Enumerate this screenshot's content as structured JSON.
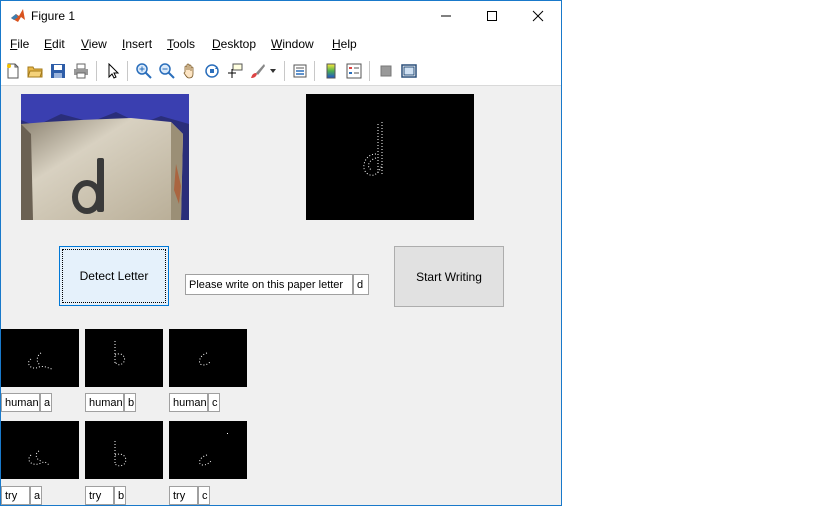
{
  "window": {
    "title": "Figure 1"
  },
  "menu": [
    "File",
    "Edit",
    "View",
    "Insert",
    "Tools",
    "Desktop",
    "Window",
    "Help"
  ],
  "toolbar": [
    "new-figure",
    "open-file",
    "save",
    "print",
    "edit-plot",
    "zoom-in",
    "zoom-out",
    "pan",
    "rotate-3d",
    "data-cursor",
    "brush",
    "link-plot",
    "colorbar",
    "legend",
    "hide-plot-tools",
    "show-plot-tools"
  ],
  "controls": {
    "detect_label": "Detect Letter",
    "instruction": "Please write on this paper letter",
    "letter": "d",
    "start_label": "Start Writing"
  },
  "human_row": [
    {
      "label": "human",
      "letter": "a"
    },
    {
      "label": "human",
      "letter": "b"
    },
    {
      "label": "human",
      "letter": "c"
    }
  ],
  "try_row": [
    {
      "label": "try",
      "letter": "a"
    },
    {
      "label": "try",
      "letter": "b"
    },
    {
      "label": "try",
      "letter": "c"
    }
  ]
}
